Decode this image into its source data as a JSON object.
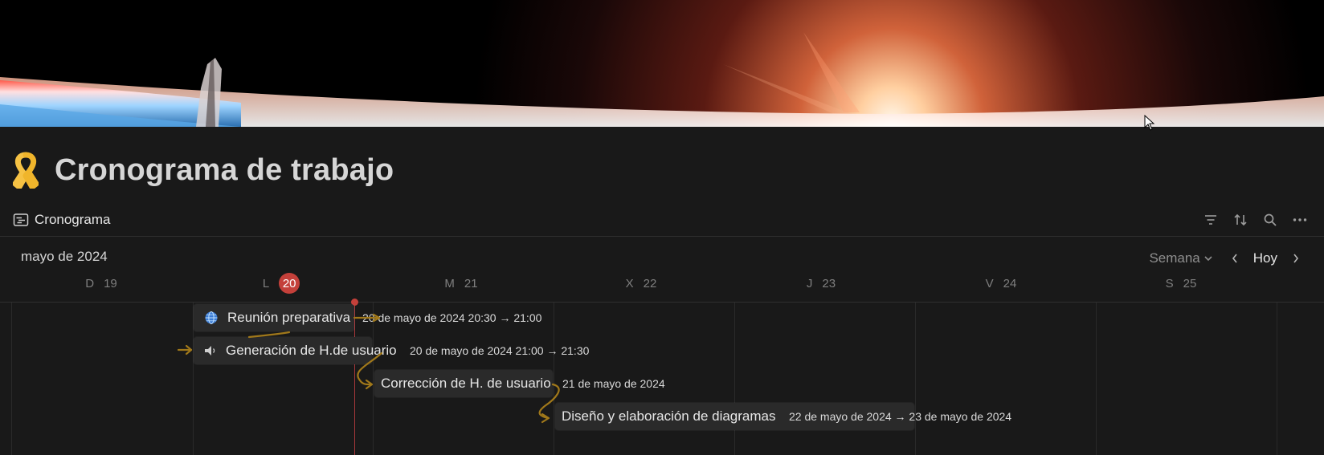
{
  "page": {
    "title": "Cronograma de trabajo",
    "icon": "yellow-ribbon-icon"
  },
  "view": {
    "tab_label": "Cronograma",
    "toolbar": [
      "filter-icon",
      "sort-icon",
      "search-icon",
      "more-icon"
    ]
  },
  "calendar": {
    "month_label": "mayo de 2024",
    "range_label": "Semana",
    "today_label": "Hoy",
    "days": [
      {
        "weekday": "D",
        "day": "19",
        "is_today": false
      },
      {
        "weekday": "L",
        "day": "20",
        "is_today": true
      },
      {
        "weekday": "M",
        "day": "21",
        "is_today": false
      },
      {
        "weekday": "X",
        "day": "22",
        "is_today": false
      },
      {
        "weekday": "J",
        "day": "23",
        "is_today": false
      },
      {
        "weekday": "V",
        "day": "24",
        "is_today": false
      },
      {
        "weekday": "S",
        "day": "25",
        "is_today": false
      }
    ]
  },
  "tasks": [
    {
      "name": "Reunión preparativa",
      "date": "20 de mayo de 2024 20:30 → 21:00",
      "icon": "globe-icon"
    },
    {
      "name": "Generación de H.de usuario",
      "date": "20 de mayo de 2024 21:00 → 21:30",
      "icon": "speaker-icon"
    },
    {
      "name": "Corrección de H. de usuario",
      "date": "21 de mayo de 2024",
      "icon": ""
    },
    {
      "name": "Diseño y elaboración de diagramas",
      "date": "22 de mayo de 2024 → 23 de mayo de 2024",
      "icon": ""
    }
  ],
  "colors": {
    "background": "#191919",
    "today_badge": "#c4403a",
    "dependency_arrow": "#a0781a"
  }
}
